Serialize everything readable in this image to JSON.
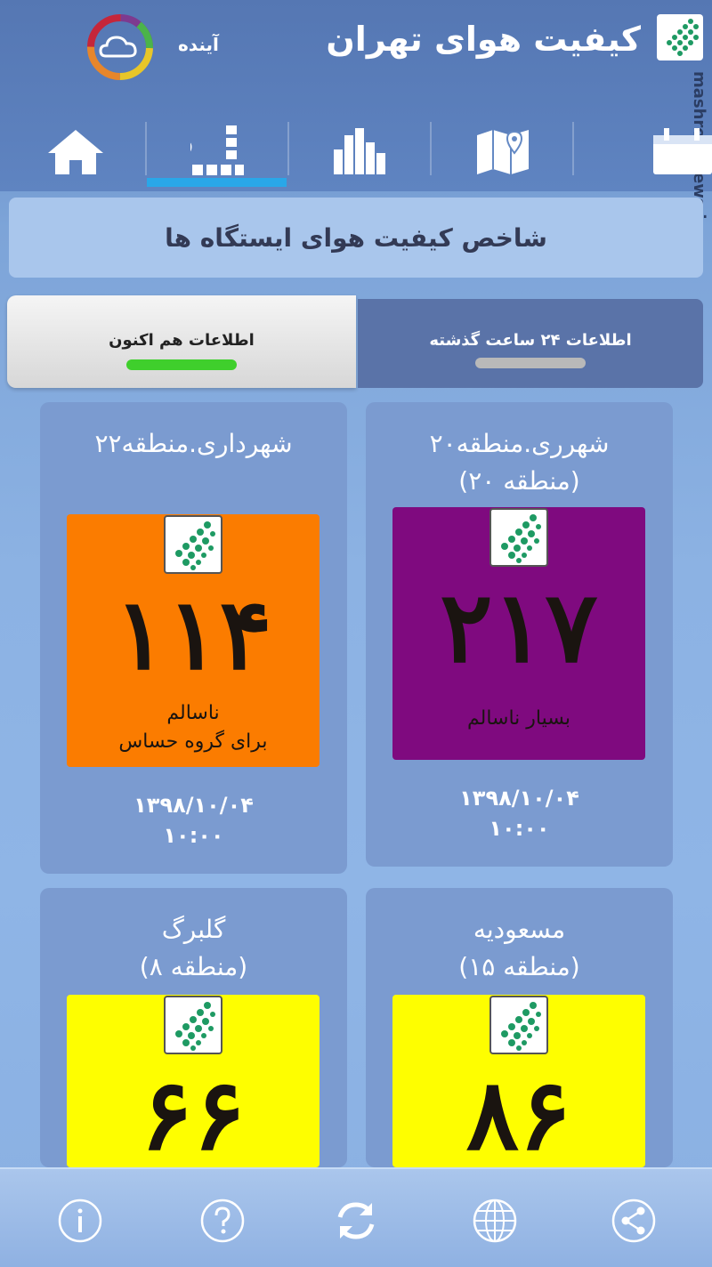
{
  "header": {
    "title": "کیفیت هوای تهران",
    "forecast_label": "آینده",
    "watermark": "mashreghnews.ir"
  },
  "nav": {
    "items": [
      {
        "name": "home",
        "icon": "home-icon"
      },
      {
        "name": "stations",
        "icon": "stations-grid-icon",
        "active": true
      },
      {
        "name": "charts",
        "icon": "bar-chart-icon"
      },
      {
        "name": "map",
        "icon": "map-pin-icon"
      },
      {
        "name": "calendar",
        "icon": "calendar-icon"
      }
    ]
  },
  "section": {
    "title": "شاخص کیفیت هوای ایستگاه ها"
  },
  "tabs": {
    "now_label": "اطلاعات هم اکنون",
    "past_label": "اطلاعات ۲۴ ساعت گذشته",
    "now_bar_color": "#3fcf2c",
    "past_bar_color": "#b9b9b9"
  },
  "stations": [
    {
      "name_line1": "شهرداری.منطقه۲۲",
      "name_line2": "",
      "aqi": "۱۱۴",
      "status_line1": "ناسالم",
      "status_line2": "برای گروه حساس",
      "color": "#fb7c00",
      "date": "۱۳۹۸/۱۰/۰۴",
      "time": "۱۰:۰۰"
    },
    {
      "name_line1": "شهرری.منطقه۲۰",
      "name_line2": "(منطقه ۲۰)",
      "aqi": "۲۱۷",
      "status_line1": "بسیار ناسالم",
      "status_line2": "",
      "color": "#7f0a7f",
      "date": "۱۳۹۸/۱۰/۰۴",
      "time": "۱۰:۰۰"
    },
    {
      "name_line1": "گلبرگ",
      "name_line2": "(منطقه ۸)",
      "aqi": "۶۶",
      "status_line1": "",
      "status_line2": "",
      "color": "#fefe00",
      "date": "",
      "time": ""
    },
    {
      "name_line1": "مسعودیه",
      "name_line2": "(منطقه ۱۵)",
      "aqi": "۸۶",
      "status_line1": "",
      "status_line2": "",
      "color": "#fefe00",
      "date": "",
      "time": ""
    }
  ],
  "bottombar": {
    "items": [
      "info-icon",
      "help-icon",
      "refresh-icon",
      "globe-icon",
      "share-icon"
    ]
  }
}
